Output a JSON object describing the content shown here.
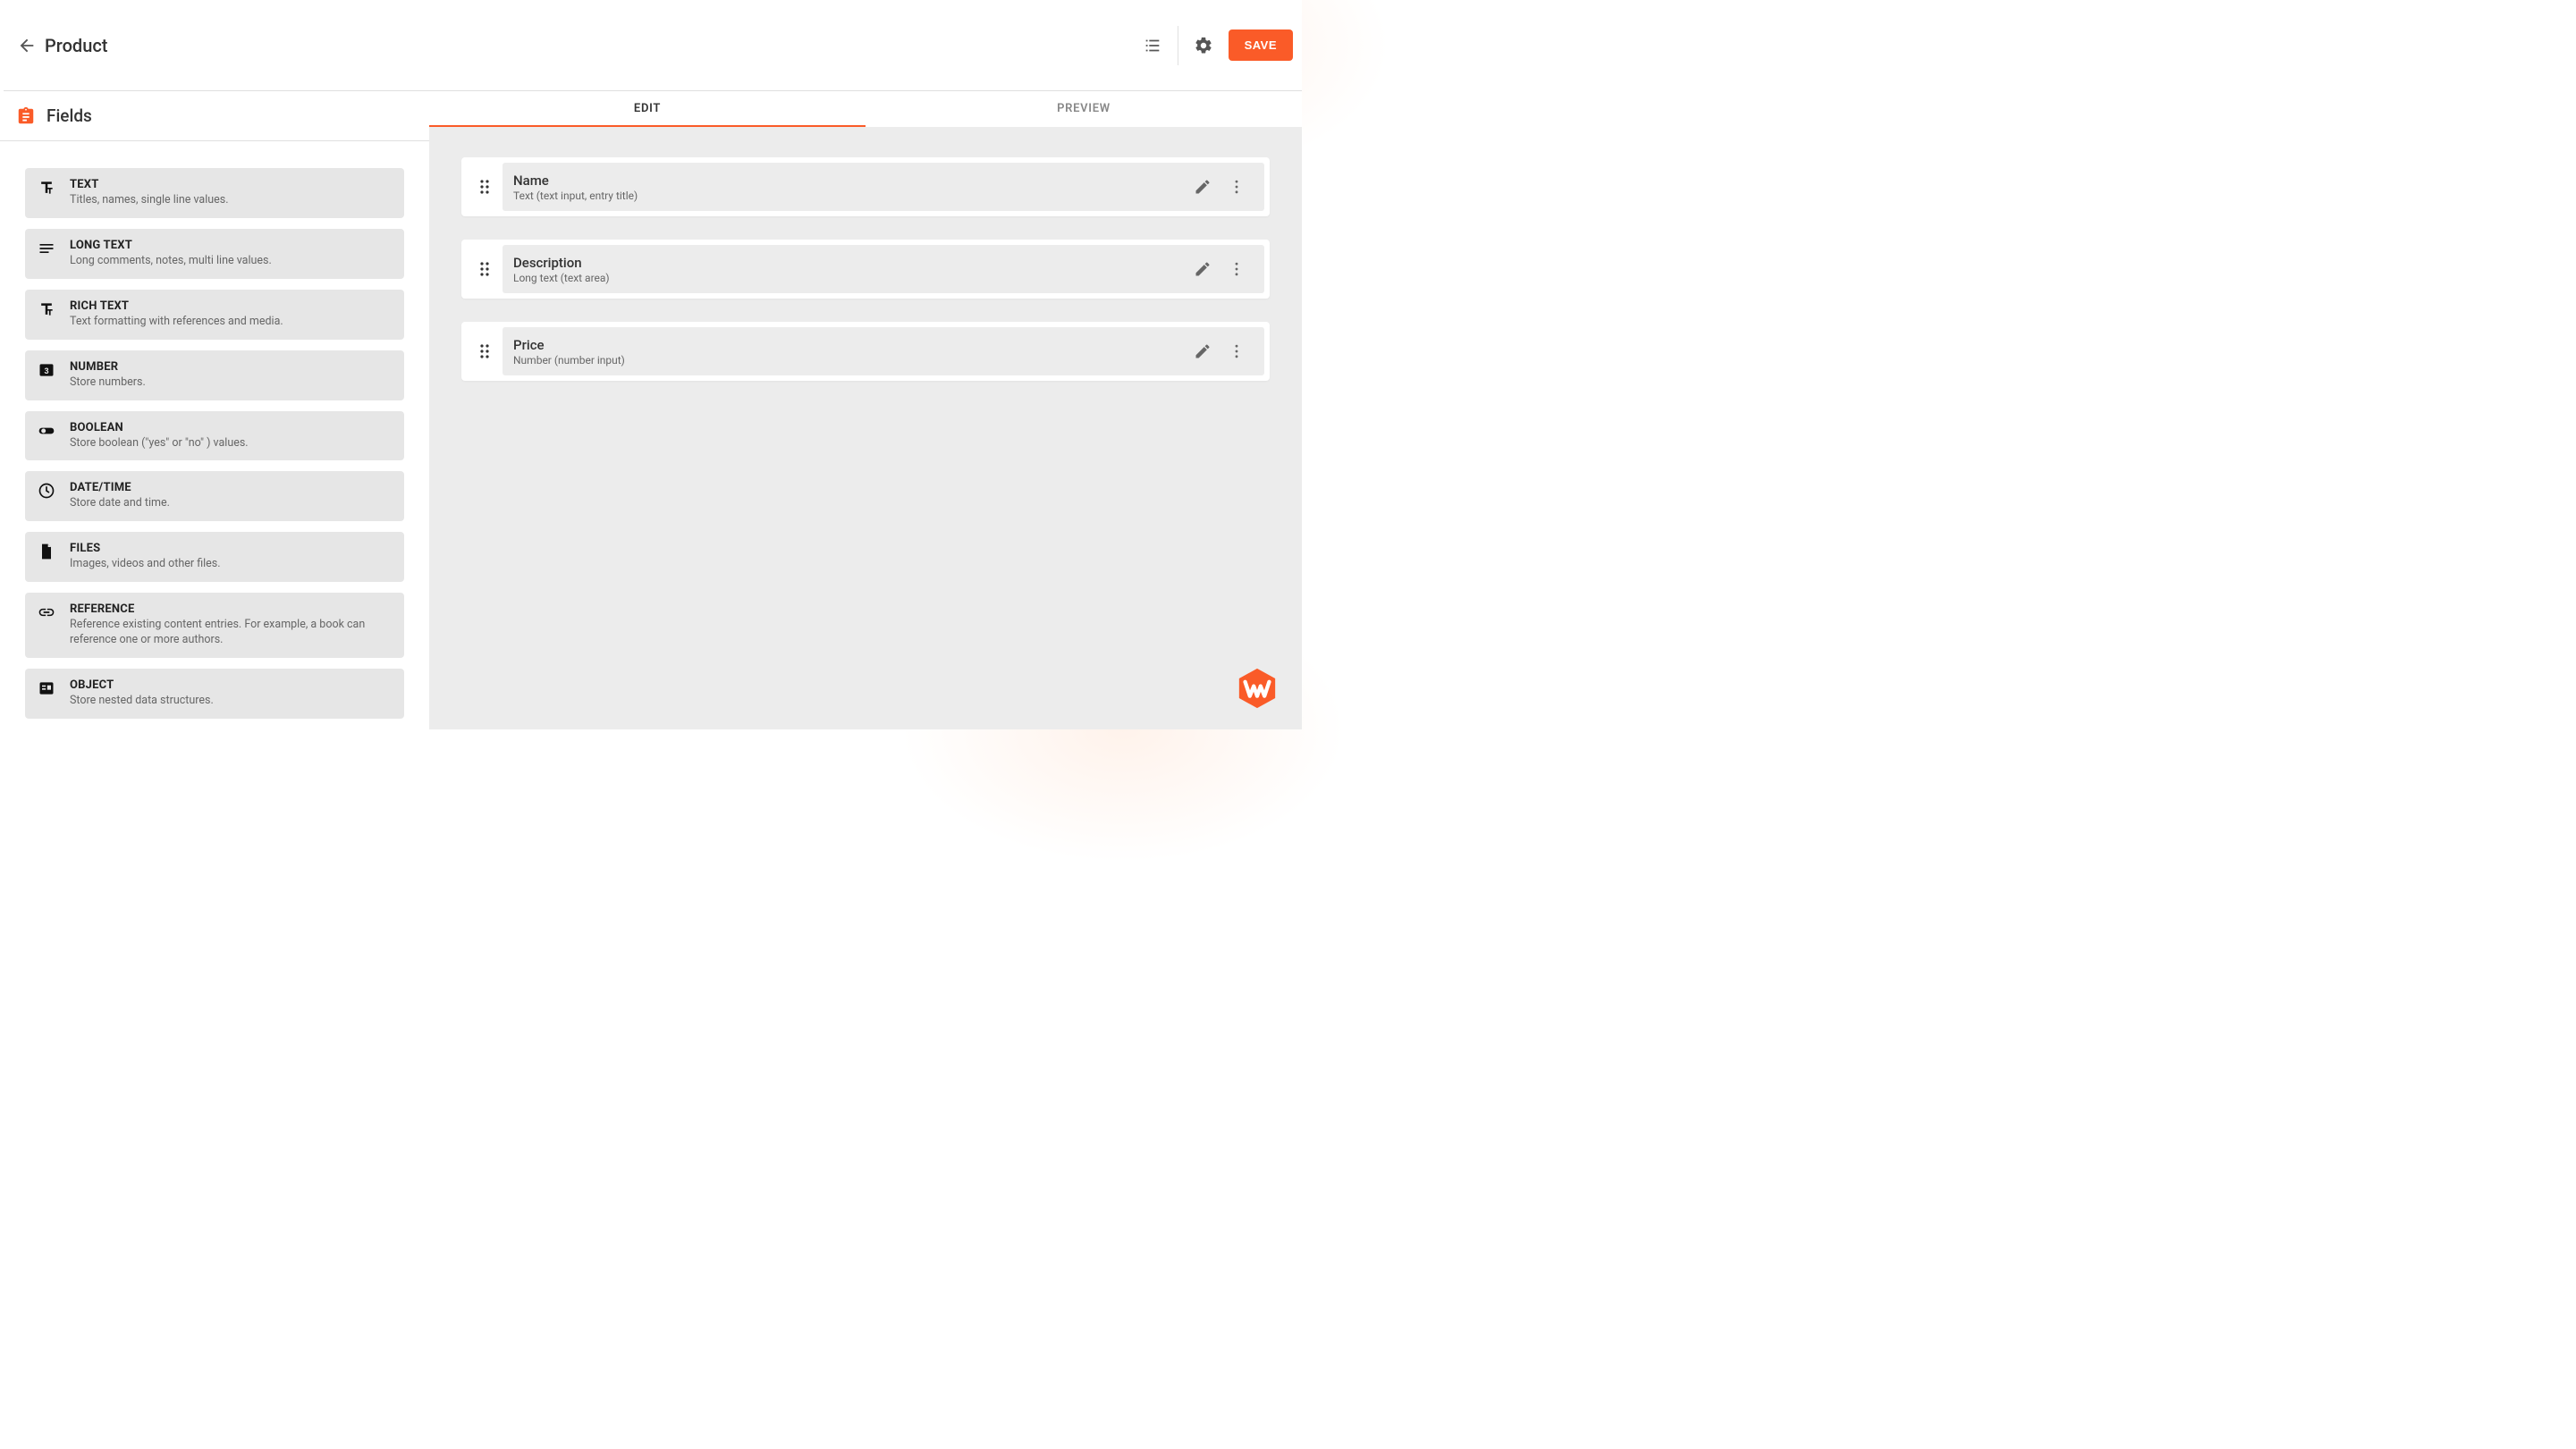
{
  "header": {
    "title": "Product",
    "save_label": "SAVE"
  },
  "tabs": {
    "edit": "EDIT",
    "preview": "PREVIEW"
  },
  "sidebar": {
    "title": "Fields",
    "types": [
      {
        "title": "TEXT",
        "desc": "Titles, names, single line values.",
        "icon": "text"
      },
      {
        "title": "LONG TEXT",
        "desc": "Long comments, notes, multi line values.",
        "icon": "longtext"
      },
      {
        "title": "RICH TEXT",
        "desc": "Text formatting with references and media.",
        "icon": "text"
      },
      {
        "title": "NUMBER",
        "desc": "Store numbers.",
        "icon": "number"
      },
      {
        "title": "BOOLEAN",
        "desc": "Store boolean (\"yes\" or \"no\" ) values.",
        "icon": "toggle"
      },
      {
        "title": "DATE/TIME",
        "desc": "Store date and time.",
        "icon": "clock"
      },
      {
        "title": "FILES",
        "desc": "Images, videos and other files.",
        "icon": "file"
      },
      {
        "title": "REFERENCE",
        "desc": "Reference existing content entries. For example, a book can reference one or more authors.",
        "icon": "link"
      },
      {
        "title": "OBJECT",
        "desc": "Store nested data structures.",
        "icon": "object"
      }
    ]
  },
  "fields": [
    {
      "name": "Name",
      "sub": "Text (text input, entry title)"
    },
    {
      "name": "Description",
      "sub": "Long text (text area)"
    },
    {
      "name": "Price",
      "sub": "Number (number input)"
    }
  ],
  "colors": {
    "accent": "#fa5b28"
  }
}
